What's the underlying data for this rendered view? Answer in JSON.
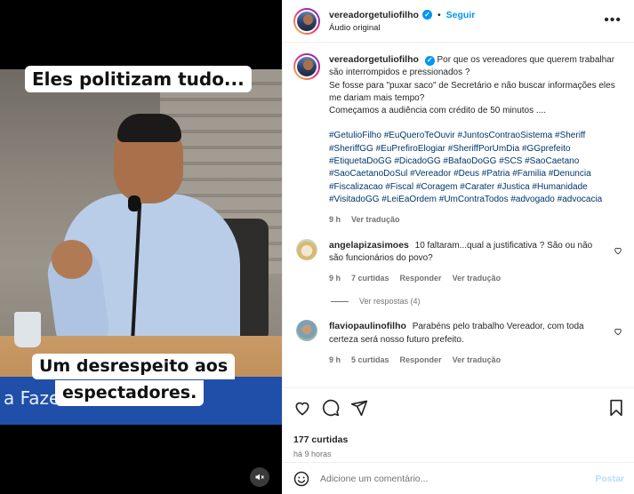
{
  "media": {
    "caption_top": "Eles politizam tudo...",
    "caption_bottom_line1": "Um desrespeito aos",
    "caption_bottom_line2": "espectadores.",
    "nameplate_fragment": "a Fazen                  re de 20",
    "mute_icon": "speaker-muted-icon"
  },
  "header": {
    "username": "vereadorgetuliofilho",
    "separator": "•",
    "follow_label": "Seguir",
    "audio_label": "Áudio original",
    "more_icon": "more-options-icon"
  },
  "post": {
    "username": "vereadorgetuliofilho",
    "text": "Por que os vereadores que querem trabalhar são interrompidos e pressionados ?\nSe fosse para \"puxar saco\" de Secretário e não buscar informações eles me dariam mais tempo?\nComeçamos a audiência com crédito de 50 minutos ....",
    "hashtags": "#GetulioFilho #EuQueroTeOuvir #JuntosContraoSistema #Sheriff #SheriffGG #EuPrefiroElogiar #SheriffPorUmDia #GGprefeito #EtiquetaDoGG #DicadoGG #BafaoDoGG #SCS #SaoCaetano #SaoCaetanoDoSul #Vereador #Deus #Patria #Familia #Denuncia #Fiscalizacao #Fiscal #Coragem #Carater #Justica #Humanidade #VisitadoGG #LeiEaOrdem #UmContraTodos #advogado #advocacia",
    "age": "9 h",
    "translate": "Ver tradução"
  },
  "comments": [
    {
      "username": "angelapizasimoes",
      "text": "10 faltaram...qual a justificativa ? São ou não são funcionários do povo?",
      "age": "9 h",
      "likes": "7 curtidas",
      "reply": "Responder",
      "translate": "Ver tradução",
      "view_replies": "Ver respostas (4)"
    },
    {
      "username": "flaviopaulinofilho",
      "text": "Parabéns pelo trabalho Vereador, com toda certeza será nosso futuro prefeito.",
      "age": "9 h",
      "likes": "5 curtidas",
      "reply": "Responder",
      "translate": "Ver tradução"
    }
  ],
  "footer": {
    "likes": "177 curtidas",
    "time": "há 9 horas",
    "comment_placeholder": "Adicione um comentário...",
    "post_label": "Postar"
  },
  "colors": {
    "accent": "#0095f6",
    "hashtag": "#00376b",
    "muted": "#737373",
    "post_disabled": "#b2dffc"
  }
}
